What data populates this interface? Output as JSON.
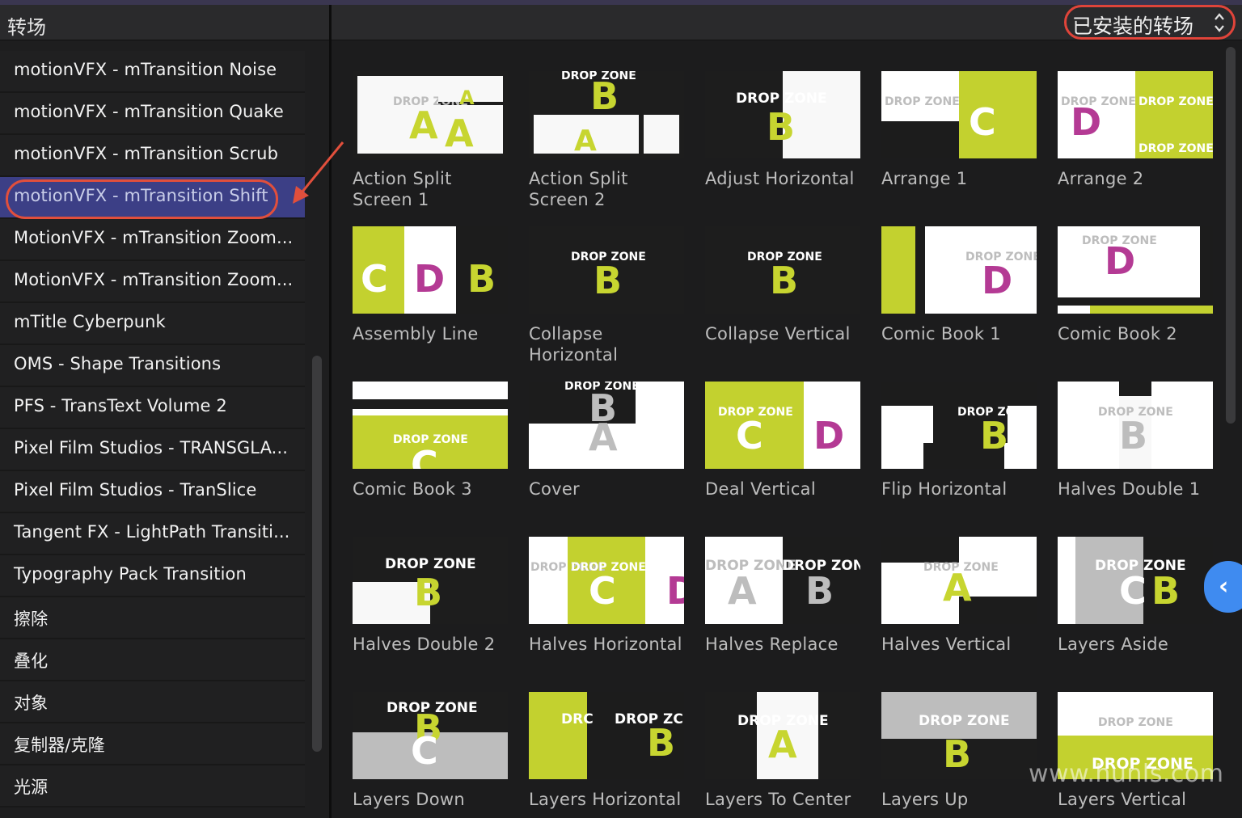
{
  "sidebar": {
    "title": "转场",
    "items": [
      {
        "label": "motionVFX - mTransition Noise"
      },
      {
        "label": "motionVFX - mTransition Quake"
      },
      {
        "label": "motionVFX - mTransition Scrub"
      },
      {
        "label": "motionVFX - mTransition Shift",
        "selected": true
      },
      {
        "label": "MotionVFX - mTransition Zoom..."
      },
      {
        "label": "MotionVFX - mTransition Zoom..."
      },
      {
        "label": "mTitle Cyberpunk"
      },
      {
        "label": "OMS - Shape Transitions"
      },
      {
        "label": "PFS - TransText Volume 2"
      },
      {
        "label": "Pixel Film Studios - TRANSGLA..."
      },
      {
        "label": "Pixel Film Studios - TranSlice"
      },
      {
        "label": "Tangent FX - LightPath Transiti..."
      },
      {
        "label": "Typography Pack Transition"
      },
      {
        "label": "擦除"
      },
      {
        "label": "叠化"
      },
      {
        "label": "对象"
      },
      {
        "label": "复制器/克隆"
      },
      {
        "label": "光源"
      }
    ]
  },
  "browser": {
    "filter_label": "已安装的转场",
    "thumb_text": "DROP ZONE",
    "tiles": [
      {
        "label": "Action Split Screen 1"
      },
      {
        "label": "Action Split Screen 2"
      },
      {
        "label": "Adjust Horizontal"
      },
      {
        "label": "Arrange 1"
      },
      {
        "label": "Arrange 2"
      },
      {
        "label": "Assembly Line"
      },
      {
        "label": "Collapse Horizontal"
      },
      {
        "label": "Collapse Vertical"
      },
      {
        "label": "Comic Book 1"
      },
      {
        "label": "Comic Book 2"
      },
      {
        "label": "Comic Book 3"
      },
      {
        "label": "Cover"
      },
      {
        "label": "Deal Vertical"
      },
      {
        "label": "Flip Horizontal"
      },
      {
        "label": "Halves Double 1"
      },
      {
        "label": "Halves Double 2"
      },
      {
        "label": "Halves Horizontal"
      },
      {
        "label": "Halves Replace"
      },
      {
        "label": "Halves Vertical"
      },
      {
        "label": "Layers Aside"
      },
      {
        "label": "Layers Down"
      },
      {
        "label": "Layers Horizontal"
      },
      {
        "label": "Layers To Center"
      },
      {
        "label": "Layers Up"
      },
      {
        "label": "Layers Vertical"
      }
    ]
  },
  "watermark": "www.hunls.com",
  "colors": {
    "accent_lime": "#c3d12f",
    "accent_magenta": "#b43a94",
    "selection": "#3c3f86",
    "annotation_red": "#e14f3c",
    "tab_blue": "#3f8bf0"
  },
  "icons": {
    "dropdown": "updown-chevron-icon",
    "collapse_tab": "chevron-left-icon",
    "annotation": "red-arrow-icon"
  }
}
